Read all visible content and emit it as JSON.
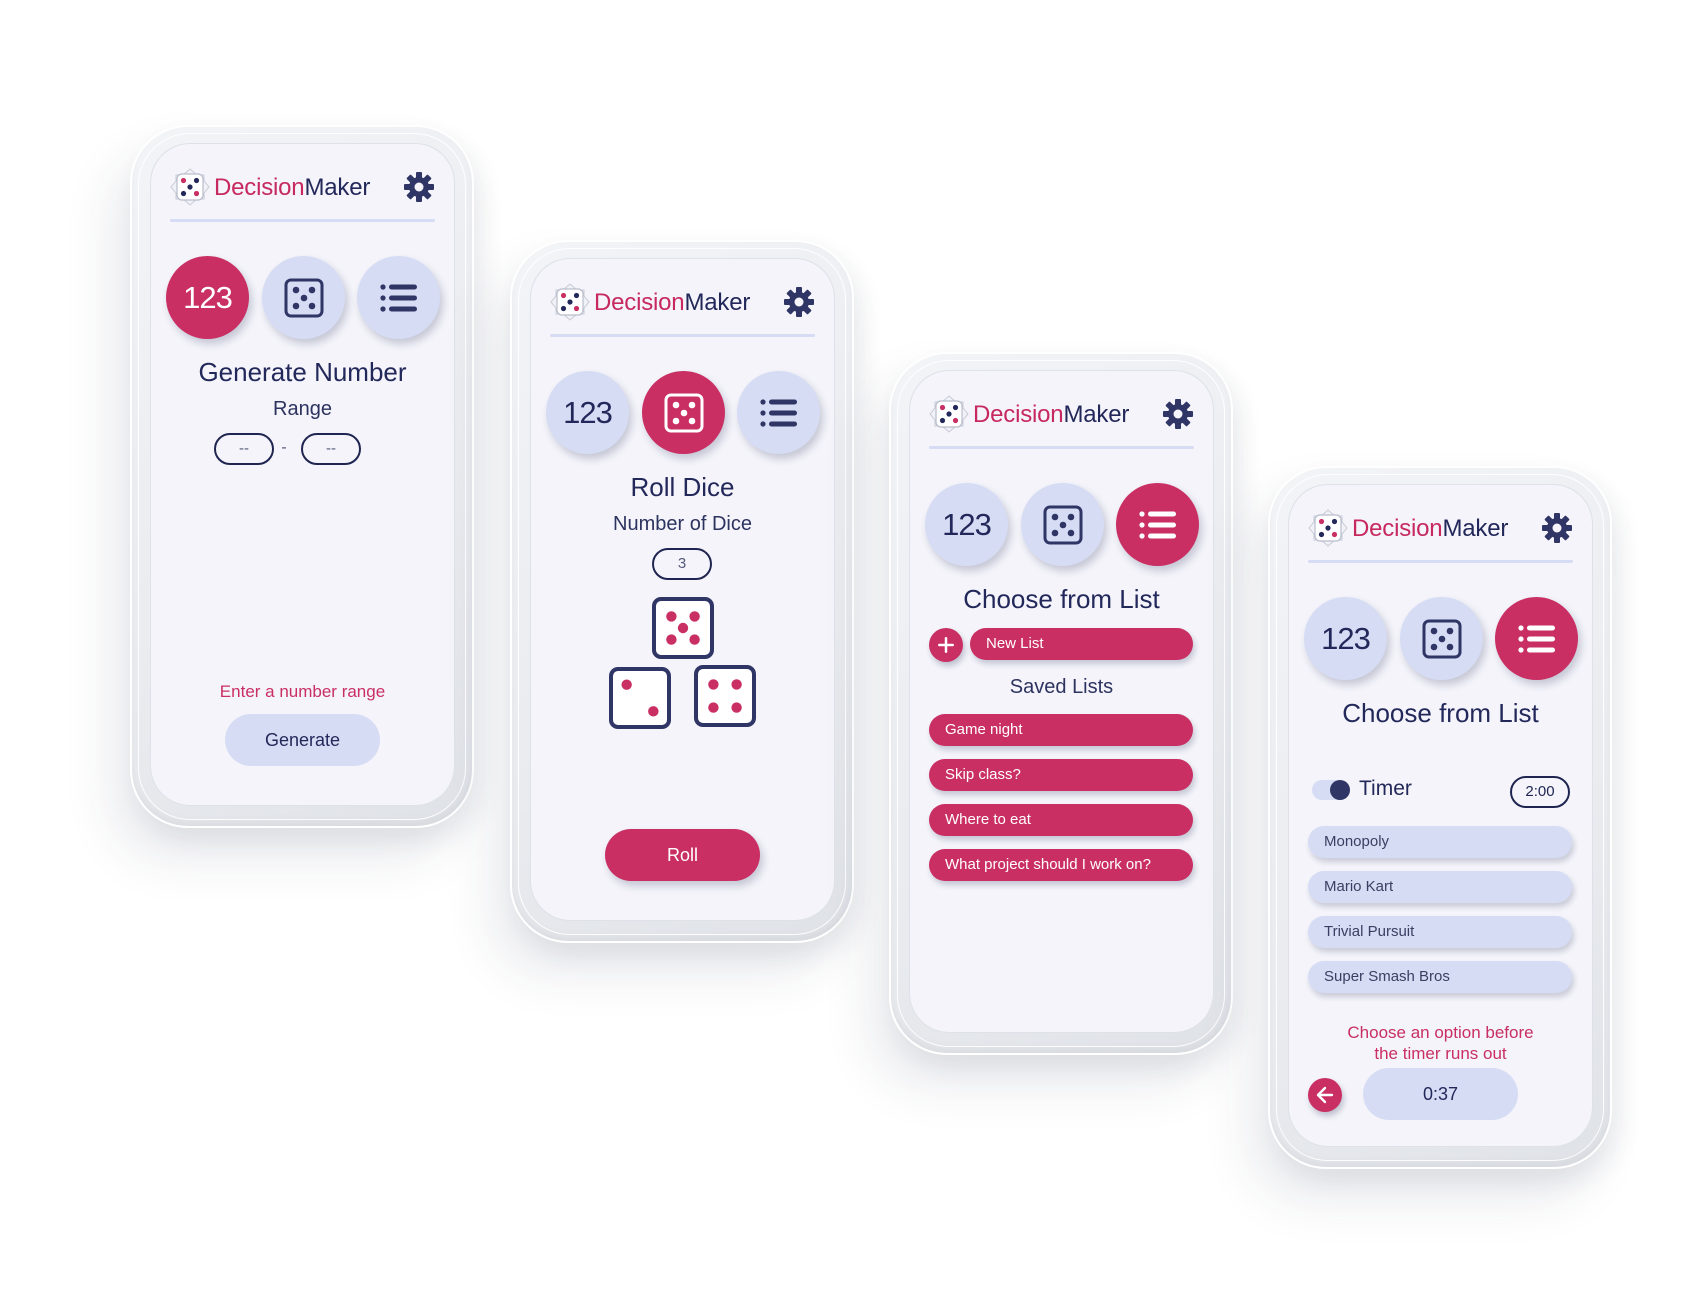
{
  "app": {
    "brand_part1": "Decision",
    "brand_part2": "Maker",
    "colors": {
      "accent": "#c92f63",
      "navy": "#23285a",
      "soft": "#d6dcf4",
      "screen_bg": "#f4f4fa"
    },
    "icons": {
      "logo": "dice-logo-icon",
      "settings": "gear-icon",
      "dice_mode": "dice-five-icon",
      "list_mode": "list-icon"
    }
  },
  "modes": {
    "number_label": "123"
  },
  "screens": [
    {
      "active_mode": "number",
      "title": "Generate Number",
      "range_label": "Range",
      "range_min_placeholder": "--",
      "range_separator": "-",
      "range_max_placeholder": "--",
      "hint": "Enter a number range",
      "button": "Generate"
    },
    {
      "active_mode": "dice",
      "title": "Roll Dice",
      "count_label": "Number of Dice",
      "count_value": "3",
      "dice_values": [
        5,
        2,
        4
      ],
      "button": "Roll"
    },
    {
      "active_mode": "list",
      "title": "Choose from List",
      "new_list_label": "New List",
      "saved_lists_label": "Saved Lists",
      "saved_lists": [
        "Game night",
        "Skip class?",
        "Where to eat",
        "What project should I work on?"
      ]
    },
    {
      "active_mode": "list",
      "title": "Choose from List",
      "timer_label": "Timer",
      "timer_enabled": true,
      "timer_value": "2:00",
      "options": [
        "Monopoly",
        "Mario Kart",
        "Trivial Pursuit",
        "Super Smash Bros"
      ],
      "hint_line1": "Choose an option before",
      "hint_line2": "the timer runs out",
      "countdown": "0:37"
    }
  ]
}
